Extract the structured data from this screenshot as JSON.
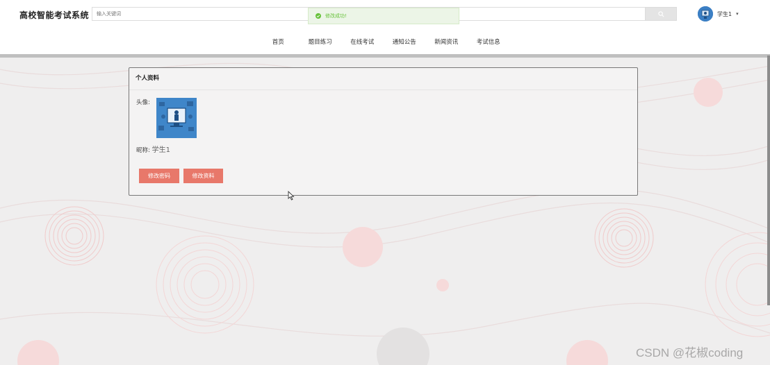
{
  "header": {
    "brand": "高校智能考试系统",
    "search_placeholder": "输入关键词",
    "toast": "修改成功!",
    "username": "学生1"
  },
  "nav": {
    "items": [
      {
        "label": "首页",
        "color": "#1fa39a"
      },
      {
        "label": "题目练习",
        "color": "#e8786a"
      },
      {
        "label": "在线考试",
        "color": "#e9b66b"
      },
      {
        "label": "通知公告",
        "color": "#3a86c8"
      },
      {
        "label": "新闻资讯",
        "color": "#1fa39a"
      },
      {
        "label": "考试信息",
        "color": "#e8786a"
      }
    ]
  },
  "profile": {
    "title": "个人资料",
    "avatar_label": "头像:",
    "nickname_label": "昵称:",
    "nickname_value": "学生1",
    "change_password_label": "修改密码",
    "edit_profile_label": "修改资料"
  },
  "watermark": "CSDN @花椒coding",
  "colors": {
    "accent_button": "#e8786a",
    "success": "#67c23a",
    "teal": "#1fa39a",
    "orange": "#e9b66b",
    "blue": "#3a86c8"
  }
}
